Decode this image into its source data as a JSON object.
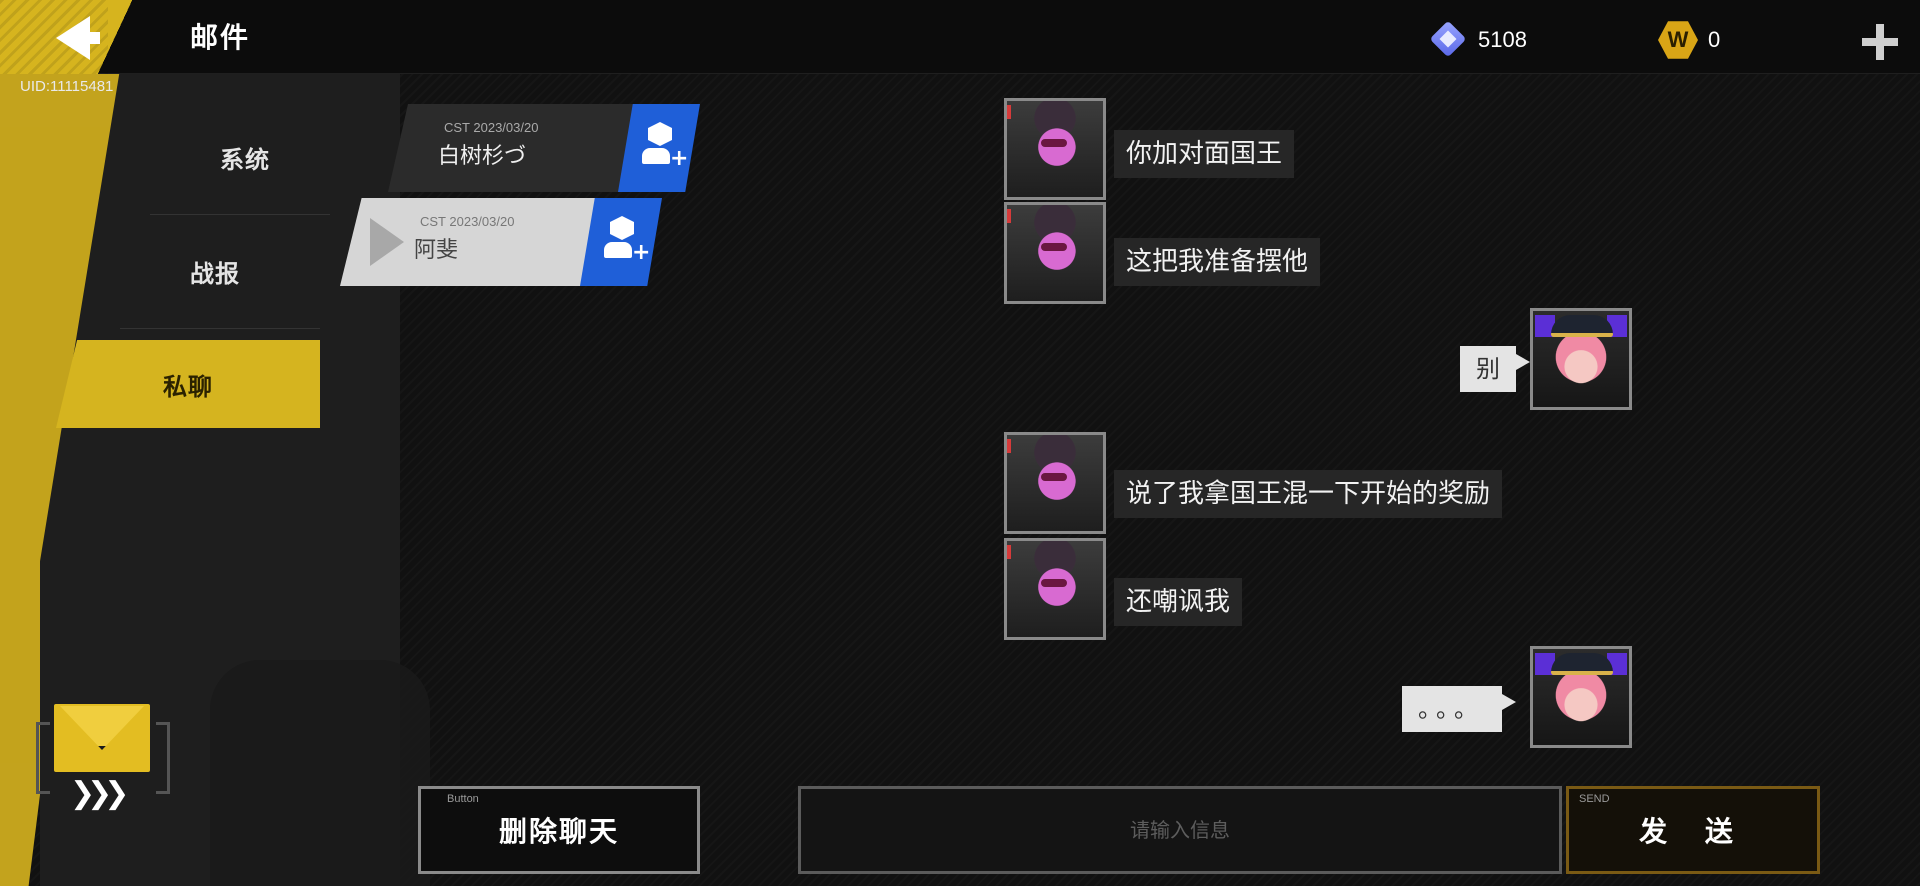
{
  "header": {
    "title": "邮件",
    "uid": "UID:11115481",
    "currencies": [
      {
        "icon": "gem-icon",
        "value": "5108"
      },
      {
        "icon": "coin-icon",
        "symbol": "W",
        "value": "0"
      }
    ]
  },
  "sidebar": {
    "items": [
      {
        "label": "系统",
        "active": false
      },
      {
        "label": "战报",
        "active": false
      },
      {
        "label": "私聊",
        "active": true
      }
    ]
  },
  "contacts": [
    {
      "date": "CST 2023/03/20",
      "name": "白树杉づ",
      "selected": false
    },
    {
      "date": "CST 2023/03/20",
      "name": "阿斐",
      "selected": true
    }
  ],
  "messages": [
    {
      "side": "left",
      "text": "你加对面国王"
    },
    {
      "side": "left",
      "text": "这把我准备摆他"
    },
    {
      "side": "right",
      "text": "别"
    },
    {
      "side": "left",
      "text": "说了我拿国王混一下开始的奖励"
    },
    {
      "side": "left",
      "text": "还嘲讽我"
    },
    {
      "side": "right",
      "text": "。。。"
    }
  ],
  "footer": {
    "delete_tag": "Button",
    "delete_label": "删除聊天",
    "input_placeholder": "请输入信息",
    "send_tag": "SEND",
    "send_label": "发 送"
  },
  "colors": {
    "accent_yellow": "#d5b41f",
    "add_blue": "#1f5fd8",
    "send_border": "#7a5a14"
  }
}
